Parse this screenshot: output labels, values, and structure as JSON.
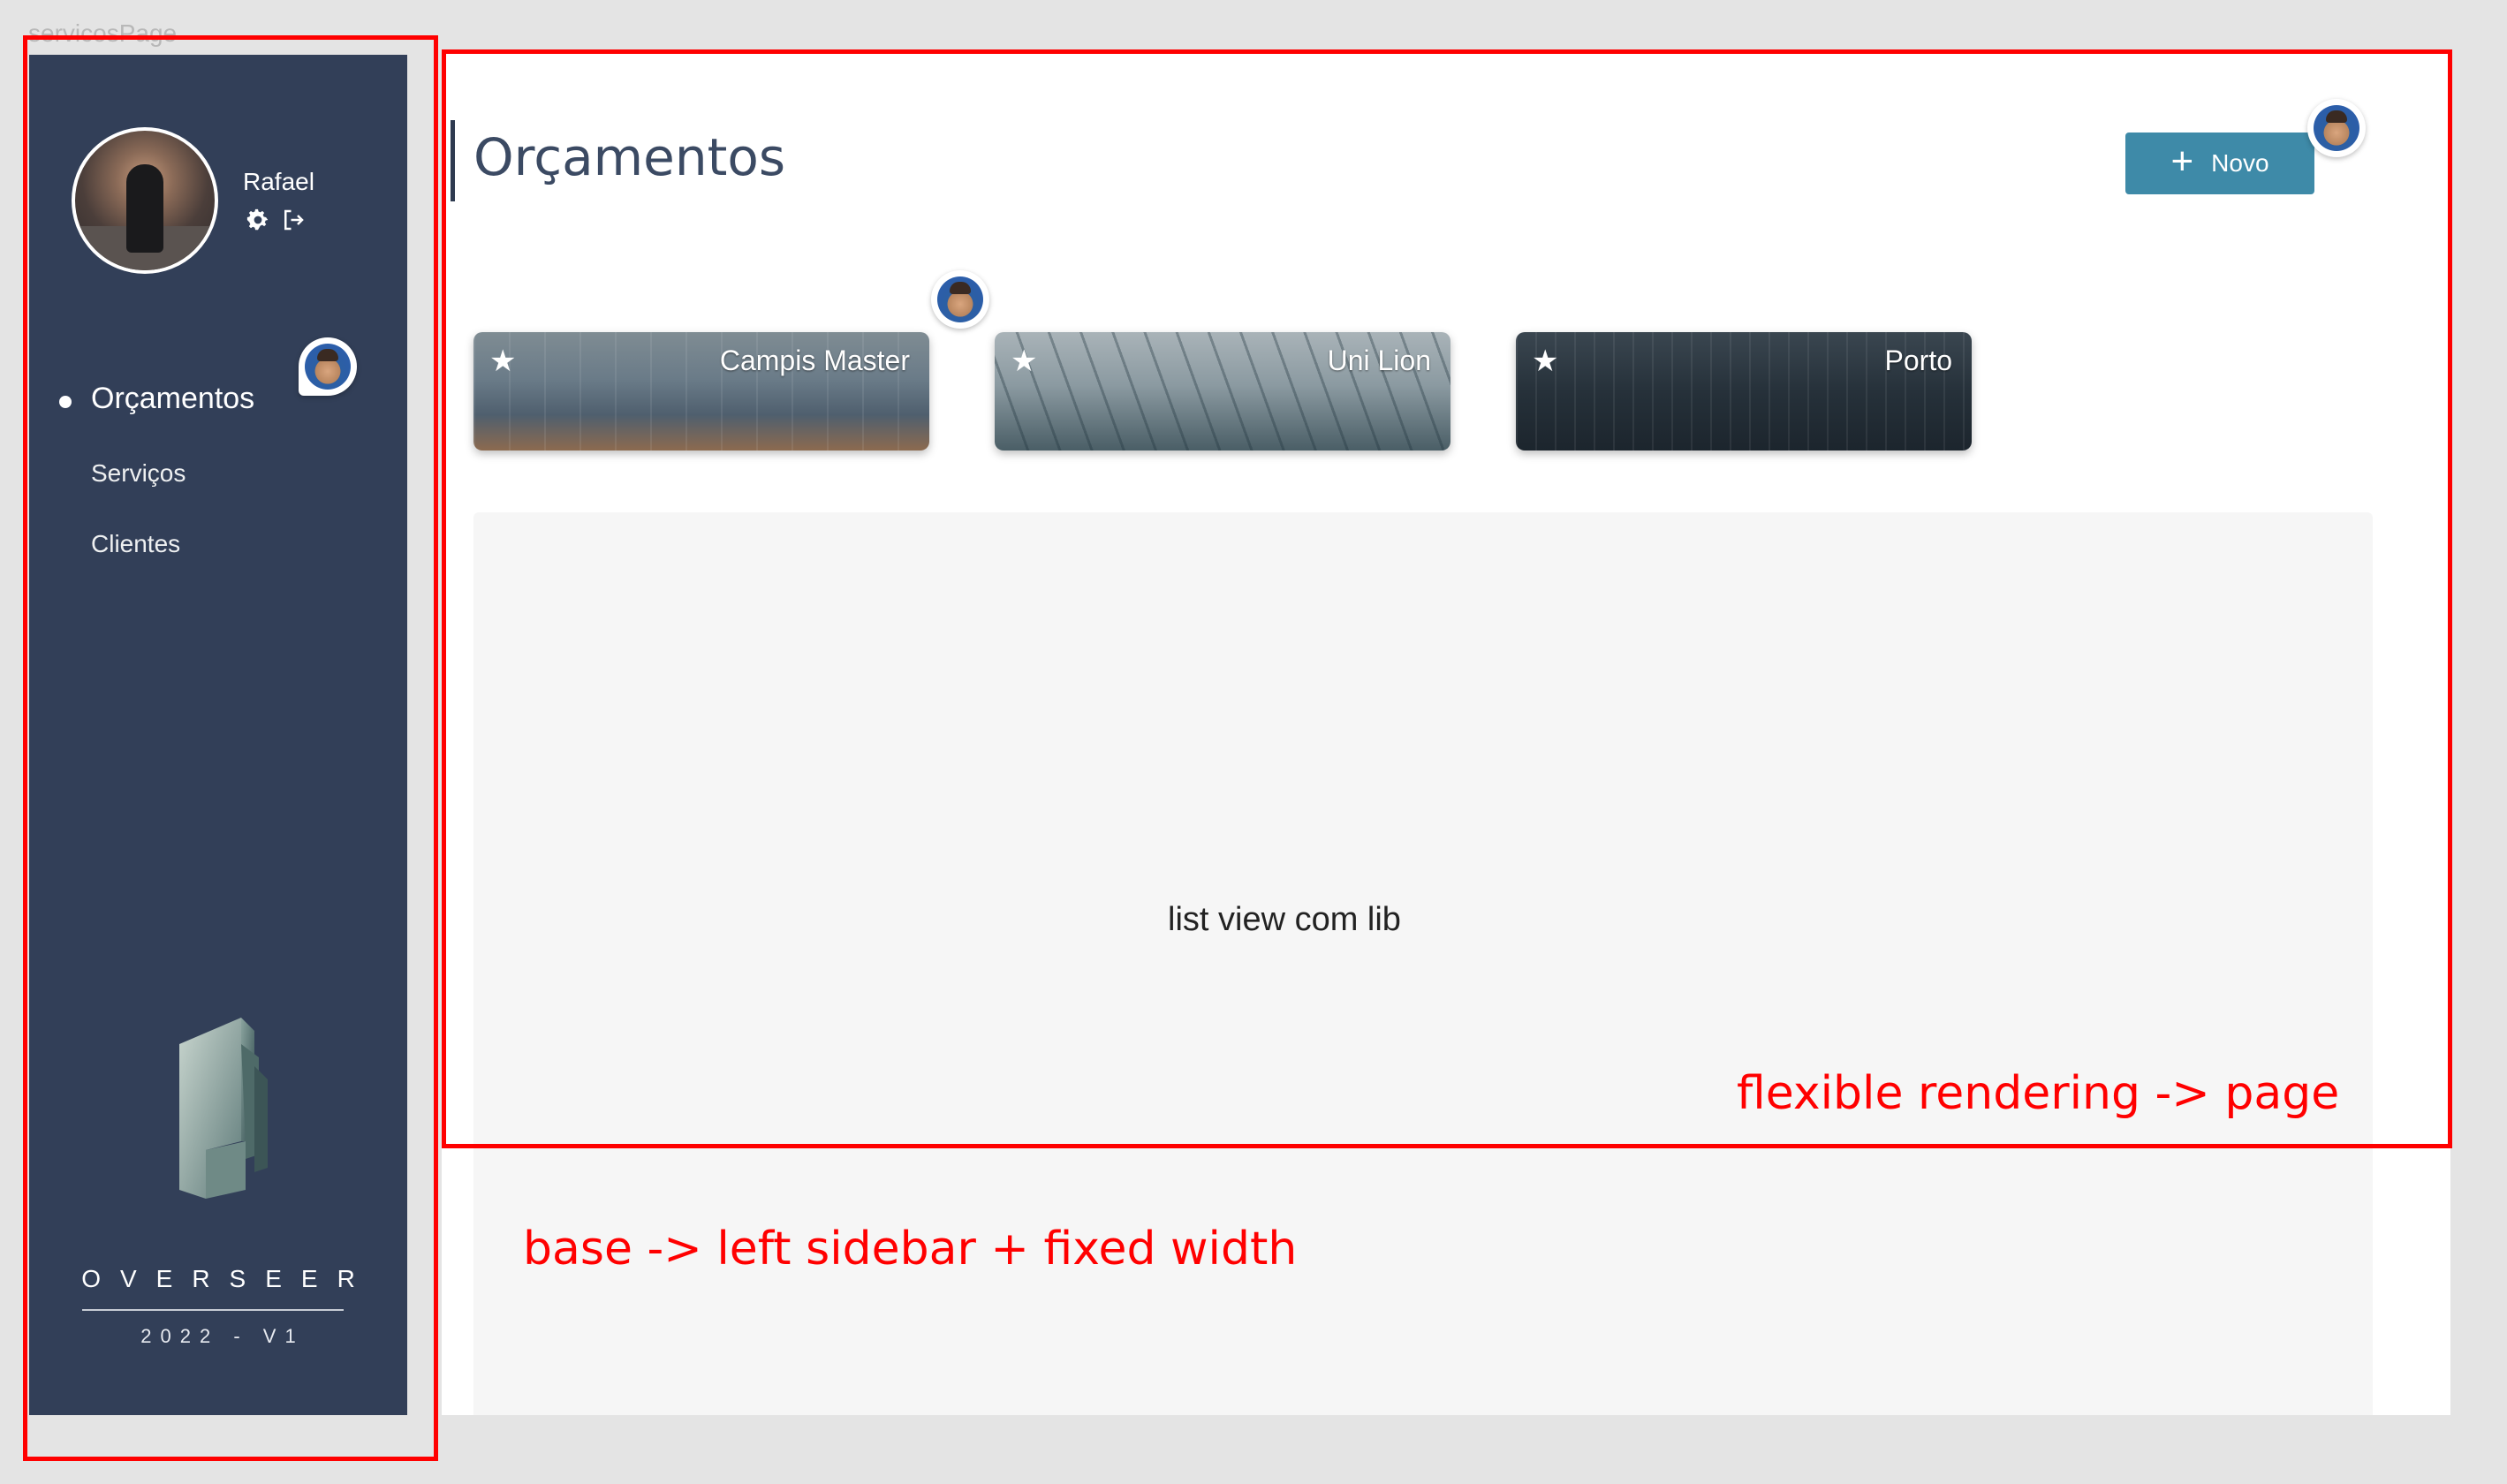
{
  "frame": {
    "label": "servicosPage"
  },
  "sidebar": {
    "user": {
      "name": "Rafael",
      "settings_icon": "gear-icon",
      "logout_icon": "logout-icon"
    },
    "nav": [
      {
        "label": "Orçamentos",
        "active": true
      },
      {
        "label": "Serviços",
        "active": false
      },
      {
        "label": "Clientes",
        "active": false
      }
    ],
    "brand": "OVERSEER",
    "version": "2022 - V1",
    "color": "#323f58"
  },
  "main": {
    "title": "Orçamentos",
    "new_button": {
      "label": "Novo",
      "icon": "plus-icon",
      "color": "#3e8aa8"
    },
    "cards": [
      {
        "title": "Campis Master",
        "icon": "star-icon"
      },
      {
        "title": "Uni Lion",
        "icon": "star-icon"
      },
      {
        "title": "Porto",
        "icon": "star-icon"
      }
    ],
    "list_placeholder": "list view com lib"
  },
  "annotations": {
    "page_note": "flexible rendering -> page",
    "sidebar_note": "base -> left sidebar + fixed width",
    "color": "#ff0000"
  }
}
